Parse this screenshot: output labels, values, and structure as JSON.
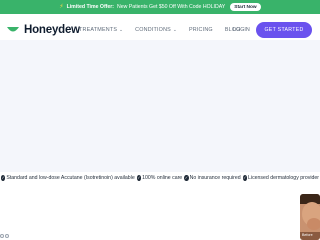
{
  "promo": {
    "bolt_icon": "lightning-icon",
    "lead": "Limited Time Offer:",
    "text": "New Patients Get $50 Off With Code HOLIDAY",
    "start_label": "Start Now"
  },
  "nav": {
    "brand": "Honeydew",
    "brand_color": "#39b36a",
    "items": [
      {
        "label": "TREATMENTS",
        "dropdown": true
      },
      {
        "label": "CONDITIONS",
        "dropdown": true
      },
      {
        "label": "PRICING",
        "dropdown": false
      },
      {
        "label": "BLOG",
        "dropdown": false
      }
    ],
    "login": "LOGIN",
    "cta": "GET STARTED",
    "cta_color": "#6a52ee"
  },
  "ticker": {
    "items": [
      "Standard and low-dose Accutane (Isotretinoin) available",
      "100% online care",
      "No insurance required",
      "Licensed dermatology provider"
    ]
  },
  "thumb": {
    "label": "Before"
  }
}
